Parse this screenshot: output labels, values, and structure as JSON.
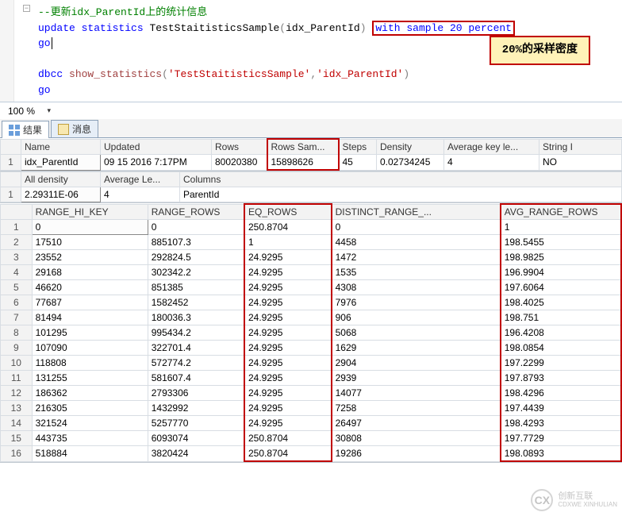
{
  "editor": {
    "comment": "--更新idx_ParentId上的统计信息",
    "kw_update": "update",
    "kw_statistics": "statistics",
    "tbl": "TestStaitisticsSample",
    "lp": "(",
    "idx": "idx_ParentId",
    "rp": ")",
    "with_sample": "with sample 20 percent",
    "go1": "go",
    "kw_dbcc": "dbcc",
    "fn": "show_statistics",
    "lp2": "(",
    "str1": "'TestStaitisticsSample'",
    "comma": ",",
    "str2": "'idx_ParentId'",
    "rp2": ")",
    "go2": "go",
    "callout": "20%的采样密度"
  },
  "zoom": {
    "value": "100 %"
  },
  "tabs": {
    "results": "结果",
    "messages": "消息"
  },
  "grid1": {
    "headers": [
      "Name",
      "Updated",
      "Rows",
      "Rows Sam...",
      "Steps",
      "Density",
      "Average key le...",
      "String I"
    ],
    "row": [
      "idx_ParentId",
      "09 15 2016  7:17PM",
      "80020380",
      "15898626",
      "45",
      "0.02734245",
      "4",
      "NO"
    ]
  },
  "grid2": {
    "headers": [
      "All density",
      "Average Le...",
      "Columns"
    ],
    "row": [
      "2.29311E-06",
      "4",
      "ParentId"
    ]
  },
  "grid3": {
    "headers": [
      "RANGE_HI_KEY",
      "RANGE_ROWS",
      "EQ_ROWS",
      "DISTINCT_RANGE_...",
      "AVG_RANGE_ROWS"
    ],
    "rows": [
      [
        "0",
        "0",
        "250.8704",
        "0",
        "1"
      ],
      [
        "17510",
        "885107.3",
        "1",
        "4458",
        "198.5455"
      ],
      [
        "23552",
        "292824.5",
        "24.9295",
        "1472",
        "198.9825"
      ],
      [
        "29168",
        "302342.2",
        "24.9295",
        "1535",
        "196.9904"
      ],
      [
        "46620",
        "851385",
        "24.9295",
        "4308",
        "197.6064"
      ],
      [
        "77687",
        "1582452",
        "24.9295",
        "7976",
        "198.4025"
      ],
      [
        "81494",
        "180036.3",
        "24.9295",
        "906",
        "198.751"
      ],
      [
        "101295",
        "995434.2",
        "24.9295",
        "5068",
        "196.4208"
      ],
      [
        "107090",
        "322701.4",
        "24.9295",
        "1629",
        "198.0854"
      ],
      [
        "118808",
        "572774.2",
        "24.9295",
        "2904",
        "197.2299"
      ],
      [
        "131255",
        "581607.4",
        "24.9295",
        "2939",
        "197.8793"
      ],
      [
        "186362",
        "2793306",
        "24.9295",
        "14077",
        "198.4296"
      ],
      [
        "216305",
        "1432992",
        "24.9295",
        "7258",
        "197.4439"
      ],
      [
        "321524",
        "5257770",
        "24.9295",
        "26497",
        "198.4293"
      ],
      [
        "443735",
        "6093074",
        "250.8704",
        "30808",
        "197.7729"
      ],
      [
        "518884",
        "3820424",
        "250.8704",
        "19286",
        "198.0893"
      ]
    ]
  },
  "watermark": {
    "brand": "创新互联",
    "sub": "CDXWE XINHULIAN"
  }
}
